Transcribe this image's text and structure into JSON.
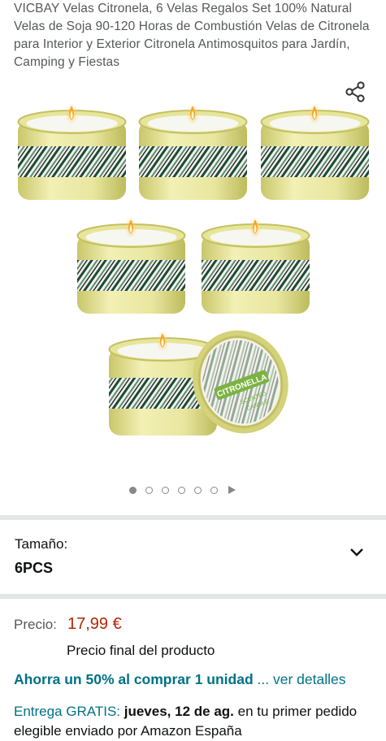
{
  "product": {
    "title": "VICBAY Velas Citronela, 6 Velas Regalos Set 100% Natural Velas de Soja 90-120 Horas de Combustión Velas de Citronela para Interior y Exterior Citronela Antimosquitos para Jardín, Camping y Fiestas"
  },
  "gallery": {
    "lid_text_1": "CITRONELLA",
    "lid_text_2": "SCENTED",
    "lid_text_3": "CANDLE",
    "dot_count": 6,
    "active_index": 0
  },
  "size": {
    "label": "Tamaño:",
    "value": "6PCS"
  },
  "price": {
    "label": "Precio:",
    "value": "17,99 €",
    "final_note": "Precio final del producto"
  },
  "promo": {
    "bold_text": "Ahorra un 50% al comprar 1 unidad",
    "link_text": "... ver detalles"
  },
  "delivery": {
    "prefix": "Entrega GRATIS:",
    "date": "jueves, 12 de ag.",
    "suffix": "en tu primer",
    "line2": "pedido elegible enviado por Amazon España"
  },
  "colors": {
    "price": "#b12704",
    "link": "#007185",
    "candle_tin": "#e7e59a"
  }
}
